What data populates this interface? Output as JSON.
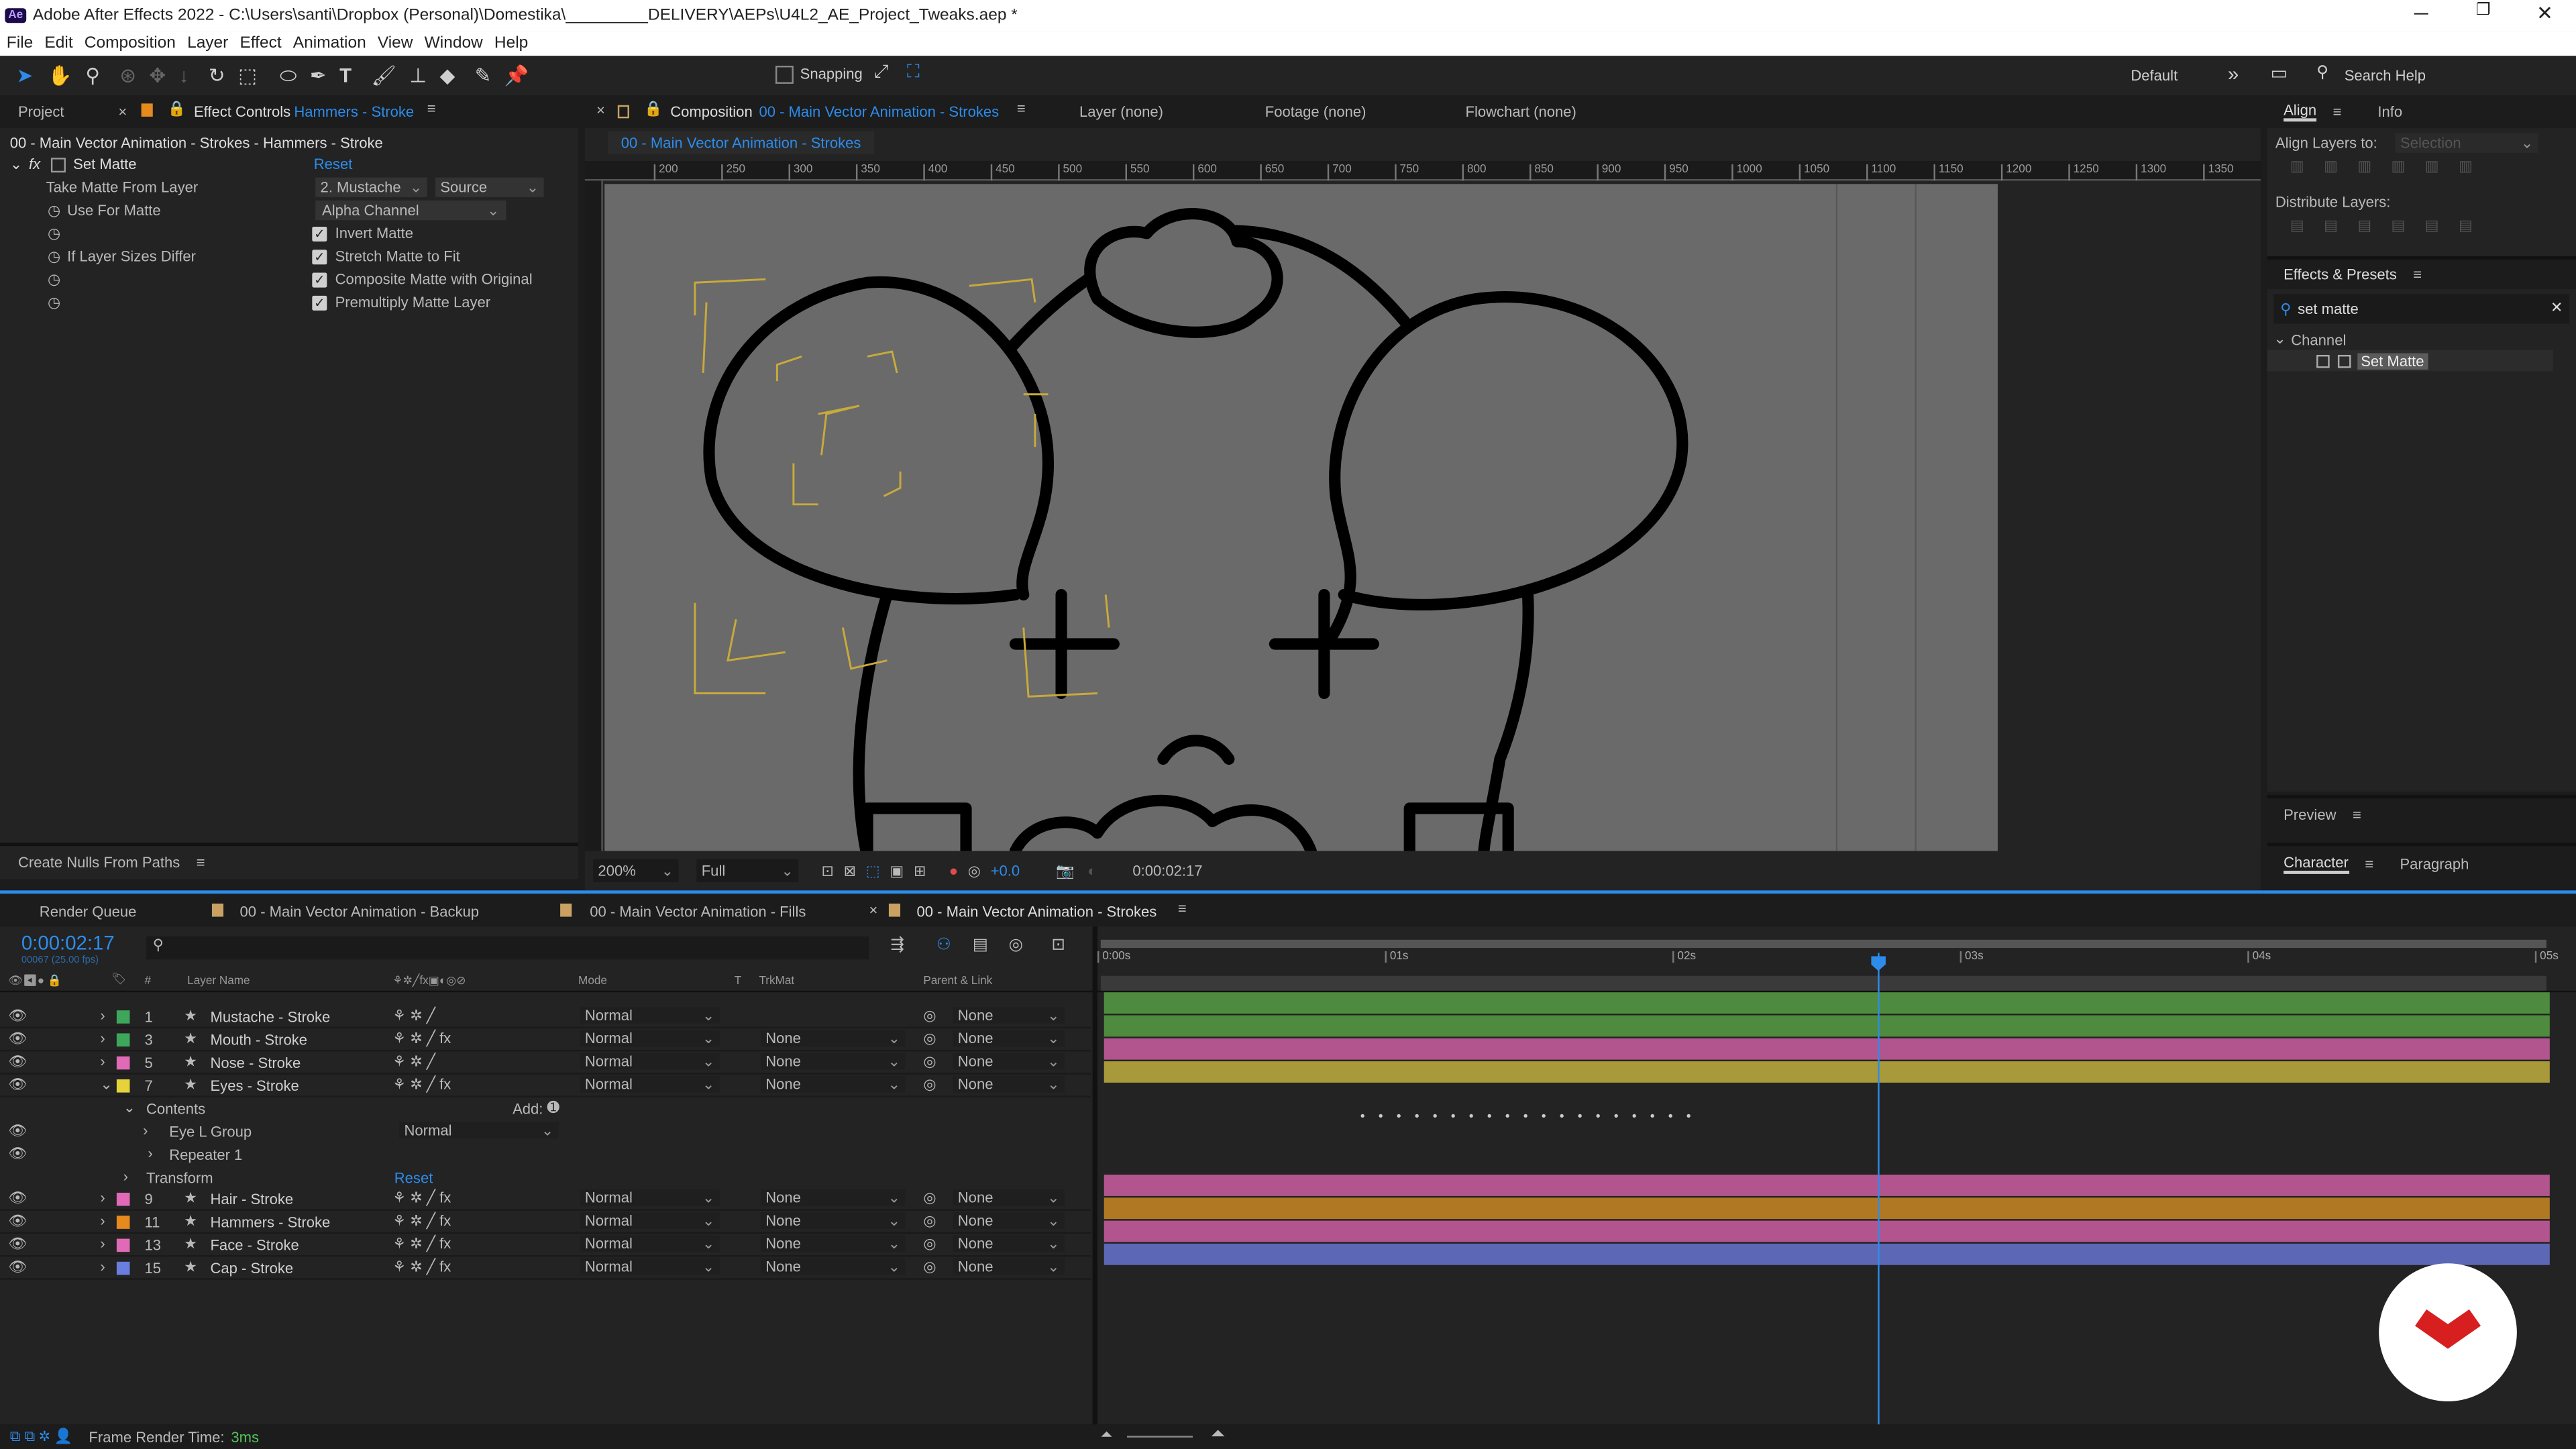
{
  "app": {
    "icon": "Ae",
    "title": "Adobe After Effects 2022 - C:\\Users\\santi\\Dropbox (Personal)\\Domestika\\_________DELIVERY\\AEPs\\U4L2_AE_Project_Tweaks.aep *"
  },
  "menu": [
    "File",
    "Edit",
    "Composition",
    "Layer",
    "Effect",
    "Animation",
    "View",
    "Window",
    "Help"
  ],
  "toolbar": {
    "snapping": "Snapping",
    "workspace": "Default",
    "search": "Search Help"
  },
  "left_panel": {
    "tab_project": "Project",
    "tab_effect": "Effect Controls",
    "tab_effect_layer": "Hammers - Stroke",
    "breadcrumb": "00 - Main Vector Animation - Strokes - Hammers - Stroke",
    "effect_name": "Set Matte",
    "reset": "Reset",
    "props": [
      {
        "label": "Take Matte From Layer",
        "value": "2. Mustache",
        "value2": "Source"
      },
      {
        "label": "Use For Matte",
        "value": "Alpha Channel"
      },
      {
        "label": "",
        "check": "Invert Matte"
      },
      {
        "label": "If Layer Sizes Differ",
        "check": "Stretch Matte to Fit"
      },
      {
        "label": "",
        "check": "Composite Matte with Original"
      },
      {
        "label": "",
        "check": "Premultiply Matte Layer"
      }
    ],
    "bottom_tab": "Create Nulls From Paths"
  },
  "comp_panel": {
    "tab_label": "Composition",
    "tab_name": "00 - Main Vector Animation - Strokes",
    "layer": "Layer (none)",
    "footage": "Footage (none)",
    "flowchart": "Flowchart (none)",
    "subtab": "00 - Main Vector Animation - Strokes",
    "ruler": [
      "200",
      "250",
      "300",
      "350",
      "400",
      "450",
      "500",
      "550",
      "600",
      "650",
      "700",
      "750",
      "800",
      "850",
      "900",
      "950",
      "1000",
      "1050",
      "1100",
      "1150",
      "1200",
      "1250",
      "1300",
      "1350"
    ],
    "zoom": "200%",
    "resolution": "Full",
    "exposure": "+0.0",
    "timecode": "0:00:02:17"
  },
  "right_panel": {
    "align_tab": "Align",
    "info_tab": "Info",
    "align_layers_to": "Align Layers to:",
    "selection": "Selection",
    "distribute": "Distribute Layers:",
    "effects_presets": "Effects & Presets",
    "search": "set matte",
    "category": "Channel",
    "result": "Set Matte",
    "preview": "Preview",
    "character": "Character",
    "paragraph": "Paragraph"
  },
  "timeline": {
    "tabs": [
      "Render Queue",
      "00 - Main Vector Animation - Backup",
      "00 - Main Vector Animation - Fills",
      "00 - Main Vector Animation - Strokes"
    ],
    "timecode": "0:00:02:17",
    "frame_info": "00067 (25.00 fps)",
    "col_headers": {
      "num": "#",
      "name": "Layer Name",
      "mode": "Mode",
      "t": "T",
      "trkmat": "TrkMat",
      "parent": "Parent & Link"
    },
    "time_labels": [
      "0:00s",
      "01s",
      "02s",
      "03s",
      "04s",
      "05s"
    ],
    "playhead_fraction": 0.535,
    "layers": [
      {
        "num": "1",
        "name": "Mustache - Stroke",
        "color": "#3da65a",
        "mode": "Normal",
        "trkmat": "",
        "parent": "None",
        "bar": "#4e8b3e"
      },
      {
        "num": "3",
        "name": "Mouth - Stroke",
        "color": "#3da65a",
        "mode": "Normal",
        "trkmat": "None",
        "parent": "None",
        "bar": "#4e8b3e"
      },
      {
        "num": "5",
        "name": "Nose - Stroke",
        "color": "#e06ab8",
        "mode": "Normal",
        "trkmat": "None",
        "parent": "None",
        "bar": "#b2558f"
      },
      {
        "num": "7",
        "name": "Eyes - Stroke",
        "color": "#e6d33c",
        "mode": "Normal",
        "trkmat": "None",
        "parent": "None",
        "bar": "#a89a3a"
      },
      {
        "num": "9",
        "name": "Hair - Stroke",
        "color": "#e06ab8",
        "mode": "Normal",
        "trkmat": "None",
        "parent": "None",
        "bar": "#b2558f"
      },
      {
        "num": "11",
        "name": "Hammers - Stroke",
        "color": "#e68a1e",
        "mode": "Normal",
        "trkmat": "None",
        "parent": "None",
        "bar": "#b07822"
      },
      {
        "num": "13",
        "name": "Face - Stroke",
        "color": "#e06ab8",
        "mode": "Normal",
        "trkmat": "None",
        "parent": "None",
        "bar": "#b2558f"
      },
      {
        "num": "15",
        "name": "Cap - Stroke",
        "color": "#6a7ee0",
        "mode": "Normal",
        "trkmat": "None",
        "parent": "None",
        "bar": "#5c68b6"
      }
    ],
    "sub": {
      "contents": "Contents",
      "add": "Add:",
      "group": "Eye L Group",
      "group_mode": "Normal",
      "repeater": "Repeater 1",
      "transform": "Transform",
      "reset": "Reset"
    },
    "status": "Frame Render Time:",
    "render_time": "3ms"
  }
}
